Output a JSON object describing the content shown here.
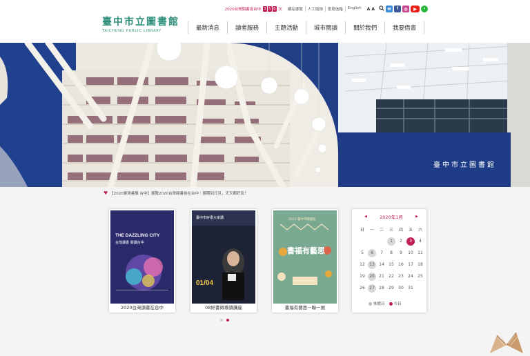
{
  "header": {
    "logo_zh": "臺中市立圖書館",
    "logo_en": "TAICHUNG PUBLIC LIBRARY",
    "visitors_prefix": "2020台灣閱書會台中",
    "visitors_digits": [
      "3",
      "5",
      "6"
    ],
    "visitors_suffix": "次",
    "utility_links": [
      "網站導覽",
      "人工諮詢",
      "意見信箱",
      "English"
    ],
    "fontsize_label": "A A"
  },
  "nav": {
    "items": [
      "最新消息",
      "讀者服務",
      "主題活動",
      "城市閱讀",
      "關於我們",
      "我要借書"
    ]
  },
  "hero": {
    "sign_text": "臺中市立圖書館"
  },
  "marquee": {
    "text": "【2020臺灣書展 台中】展覽2020台灣閱書會在台中｜展期到元旦，天天都好玩！"
  },
  "cards": [
    {
      "caption": "2020台灣讀書在台中",
      "poster_title": "THE DAZZLING CITY",
      "poster_sub": "台灣讀書 閱讀台中"
    },
    {
      "caption": "08好書徵導讀講座",
      "poster_title": "臺中市好書大家讀",
      "poster_sub": "01/04"
    },
    {
      "caption": "書福有藝思－聯一展",
      "poster_title": "書福有藝思",
      "poster_sub": "2020 臺中市圖書館"
    }
  ],
  "calendar": {
    "month_label": "2020年1月",
    "prev_label": "◀",
    "next_label": "▶",
    "weekdays": [
      "日",
      "一",
      "二",
      "三",
      "四",
      "五",
      "六"
    ],
    "weeks": [
      [
        "",
        "",
        "",
        "1",
        "2",
        "3",
        "4"
      ],
      [
        "5",
        "6",
        "7",
        "8",
        "9",
        "10",
        "11"
      ],
      [
        "12",
        "13",
        "14",
        "15",
        "16",
        "17",
        "18"
      ],
      [
        "19",
        "20",
        "21",
        "22",
        "23",
        "24",
        "25"
      ],
      [
        "26",
        "27",
        "28",
        "29",
        "30",
        "31",
        ""
      ]
    ],
    "closed_days": [
      "1",
      "6",
      "13",
      "20",
      "27",
      "3"
    ],
    "today": "3",
    "legend_closed": "休館日",
    "legend_today": "今日"
  },
  "colors": {
    "accent": "#c21e57",
    "brand": "#2e8f7a",
    "hero_blue": "#1f3e86"
  }
}
